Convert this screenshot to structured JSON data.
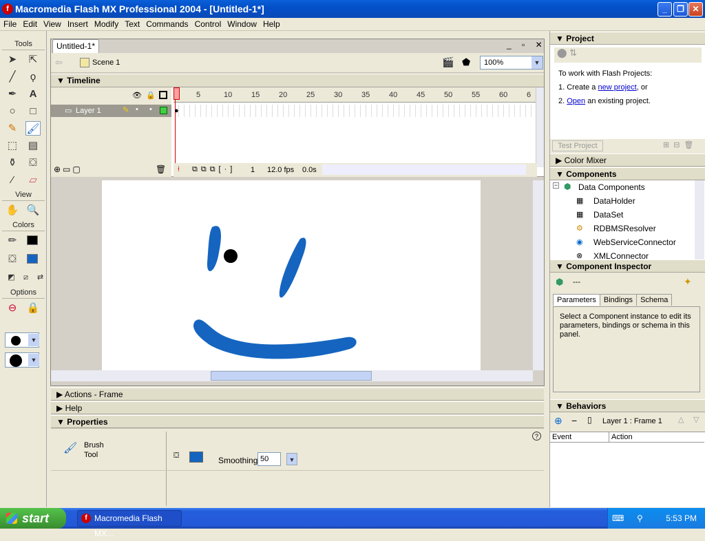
{
  "window": {
    "title": "Macromedia Flash MX Professional 2004 - [Untitled-1*]"
  },
  "menu": [
    "File",
    "Edit",
    "View",
    "Insert",
    "Modify",
    "Text",
    "Commands",
    "Control",
    "Window",
    "Help"
  ],
  "tools": {
    "heading": "Tools",
    "view_heading": "View",
    "colors_heading": "Colors",
    "options_heading": "Options"
  },
  "document": {
    "tab": "Untitled-1*",
    "scene": "Scene 1",
    "zoom": "100%"
  },
  "timeline": {
    "title": "Timeline",
    "layer_name": "Layer 1",
    "ruler_ticks": [
      "1",
      "5",
      "10",
      "15",
      "20",
      "25",
      "30",
      "35",
      "40",
      "45",
      "50",
      "55",
      "60",
      "6"
    ],
    "current_frame": "1",
    "fps": "12.0 fps",
    "time": "0.0s"
  },
  "panels": {
    "actions": "Actions - Frame",
    "help": "Help",
    "properties": "Properties"
  },
  "properties": {
    "tool_name_line1": "Brush",
    "tool_name_line2": "Tool",
    "smoothing_label": "Smoothing",
    "smoothing_value": "50"
  },
  "project": {
    "title": "Project",
    "intro": "To work with Flash Projects:",
    "step1_prefix": "1. Create a ",
    "step1_link": "new project",
    "step1_suffix": ", or",
    "step2_prefix": "2. ",
    "step2_link": "Open",
    "step2_suffix": " an existing project.",
    "test_button": "Test Project"
  },
  "color_mixer": {
    "title": "Color Mixer"
  },
  "components": {
    "title": "Components",
    "group": "Data Components",
    "items": [
      "DataHolder",
      "DataSet",
      "RDBMSResolver",
      "WebServiceConnector",
      "XMLConnector"
    ]
  },
  "inspector": {
    "title": "Component Inspector",
    "value": "---",
    "tabs": [
      "Parameters",
      "Bindings",
      "Schema"
    ],
    "message": "Select a Component instance to edit its parameters, bindings or schema in this panel."
  },
  "behaviors": {
    "title": "Behaviors",
    "context": "Layer 1 : Frame 1",
    "col_event": "Event",
    "col_action": "Action"
  },
  "taskbar": {
    "start": "start",
    "item": "Macromedia Flash MX...",
    "clock": "5:53 PM"
  },
  "colors": {
    "stroke": "#000000",
    "fill": "#1565c0",
    "brush_stroke": "#1565c0"
  }
}
